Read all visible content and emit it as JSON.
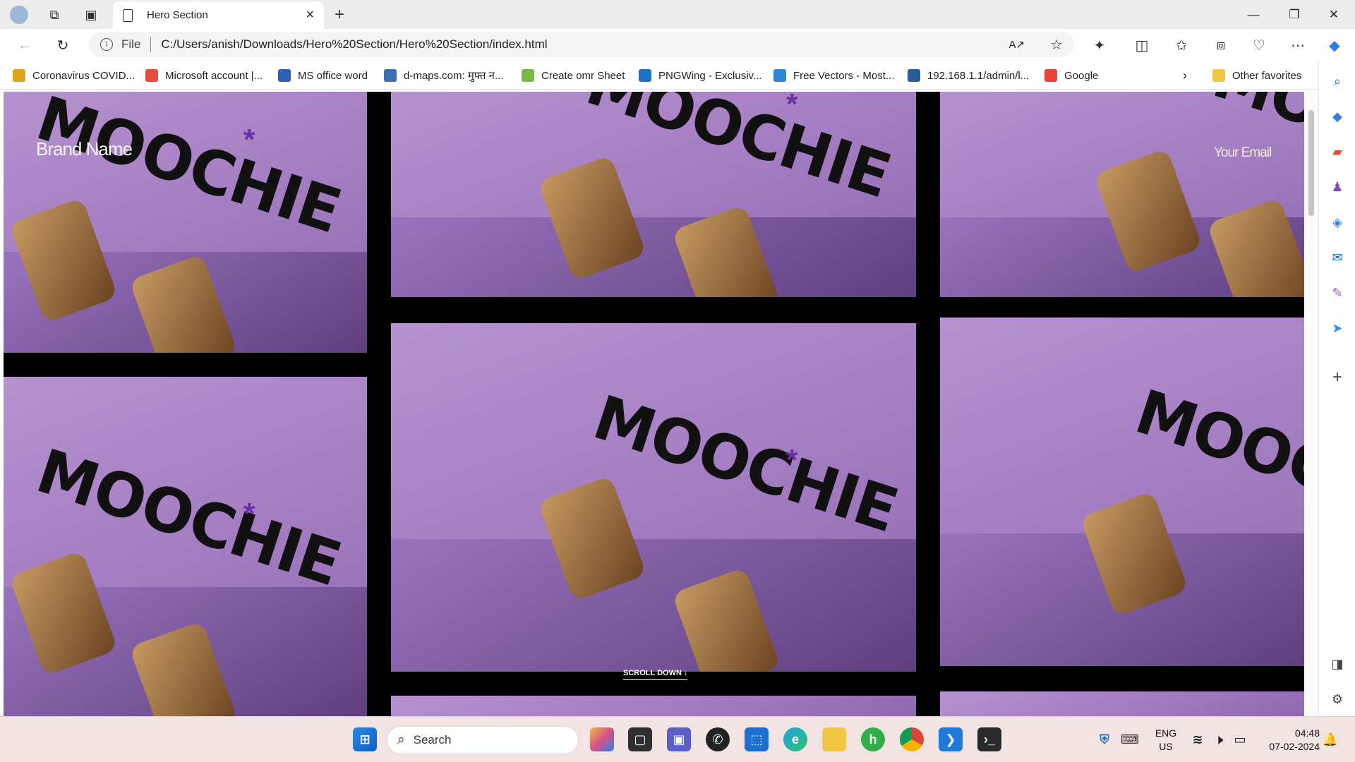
{
  "browser": {
    "tab_title": "Hero Section",
    "address_label": "File",
    "url": "C:/Users/anish/Downloads/Hero%20Section/Hero%20Section/index.html"
  },
  "favorites": [
    {
      "label": "Coronavirus COVID...",
      "color": "#e2a21a"
    },
    {
      "label": "Microsoft account |...",
      "color": "#e74c3c"
    },
    {
      "label": "MS office word",
      "color": "#2b5fb8"
    },
    {
      "label": "d-maps.com: मुफ्त न...",
      "color": "#3b6fb0"
    },
    {
      "label": "Create omr Sheet",
      "color": "#7ab648"
    },
    {
      "label": "PNGWing - Exclusiv...",
      "color": "#1e73c8"
    },
    {
      "label": "Free Vectors - Most...",
      "color": "#2f86d6"
    },
    {
      "label": "192.168.1.1/admin/l...",
      "color": "#2a5a9a"
    },
    {
      "label": "Google",
      "color": "#ea4335"
    }
  ],
  "other_favorites": "Other favorites",
  "hero": {
    "brand": "Brand Name",
    "email": "Your Email",
    "scroll": "SCROLL DOWN ↓",
    "product_word": "MOOCHIE",
    "colors": {
      "bg": "#a985c6",
      "accent": "#6a2fa6"
    }
  },
  "taskbar": {
    "search_placeholder": "Search",
    "lang": "ENG",
    "region": "US",
    "time": "04:48",
    "date": "07-02-2024"
  },
  "icons": {
    "back": "arrow-left-icon",
    "refresh": "refresh-icon",
    "star": "favorite-star-icon",
    "more": "more-icon",
    "settings": "gear-icon"
  }
}
